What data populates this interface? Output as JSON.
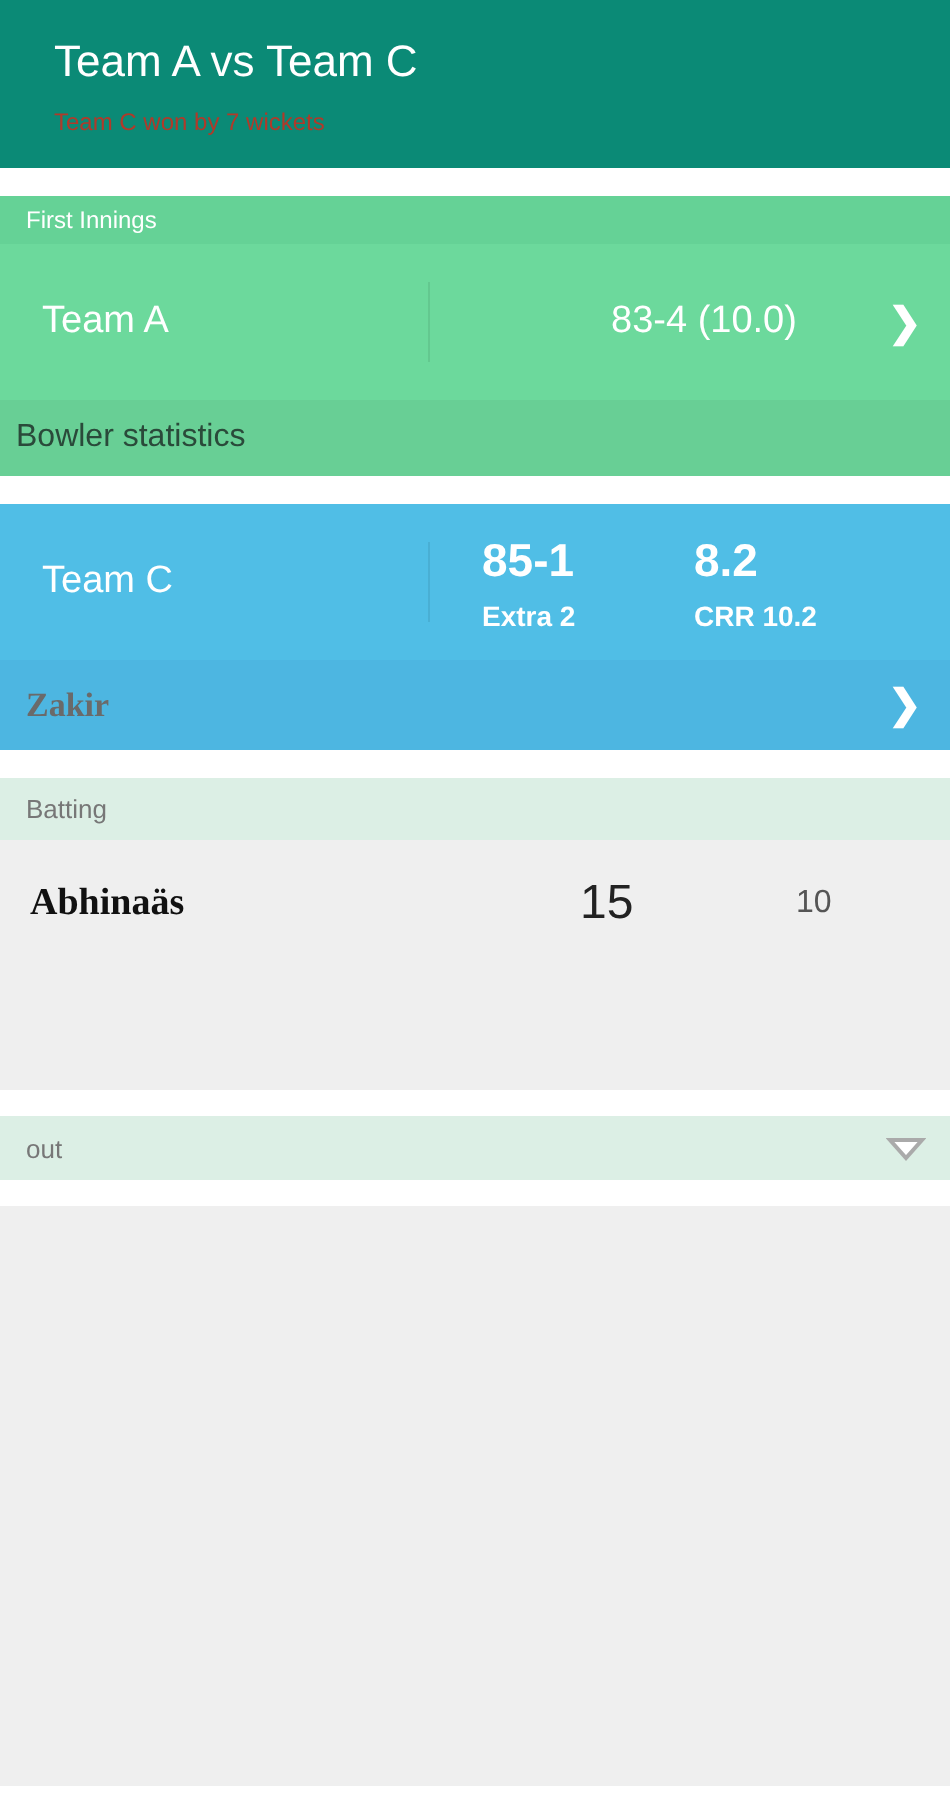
{
  "header": {
    "title": "Team A vs Team C",
    "result": "Team C won by 7 wickets"
  },
  "first_innings": {
    "label": "First Innings",
    "team": "Team A",
    "score": "83-4 (10.0)",
    "chevron": "❯",
    "footer": "Bowler statistics"
  },
  "second_innings": {
    "team": "Team C",
    "score": "85-1",
    "extras": "Extra 2",
    "overs": "8.2",
    "run_rate": "CRR 10.2",
    "bowler": "Zakir",
    "chevron": "❯"
  },
  "batting": {
    "label": "Batting",
    "rows": [
      {
        "name": "Abhinaäs",
        "runs": "15",
        "balls": "10"
      }
    ]
  },
  "out_section": {
    "label": "out"
  }
}
